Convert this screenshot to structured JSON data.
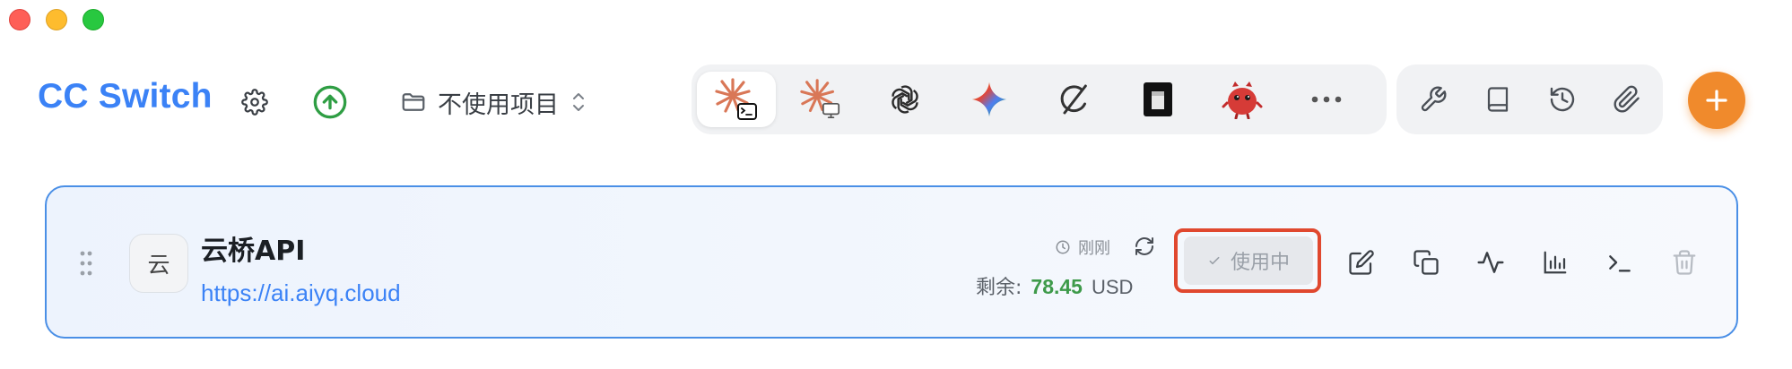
{
  "window": {
    "controls": [
      "close",
      "minimize",
      "zoom"
    ]
  },
  "header": {
    "app_title": "CC Switch",
    "settings_icon": "gear-icon",
    "update_icon": "arrow-up-circle-icon",
    "project_selector": {
      "label": "不使用项目",
      "icon": "folder-icon"
    }
  },
  "tools": [
    {
      "name": "claude-code",
      "icon": "claude-terminal-icon",
      "active": true
    },
    {
      "name": "claude-desktop",
      "icon": "claude-desktop-icon",
      "active": false
    },
    {
      "name": "openai",
      "icon": "openai-icon",
      "active": false
    },
    {
      "name": "gemini",
      "icon": "gemini-icon",
      "active": false
    },
    {
      "name": "grok",
      "icon": "grok-icon",
      "active": false
    },
    {
      "name": "dark-app",
      "icon": "box-icon",
      "active": false
    },
    {
      "name": "mascot",
      "icon": "red-mascot-icon",
      "active": false
    },
    {
      "name": "more",
      "icon": "more-icon",
      "active": false
    }
  ],
  "utilities": [
    {
      "name": "tools",
      "icon": "wrench-icon"
    },
    {
      "name": "docs",
      "icon": "book-icon"
    },
    {
      "name": "history",
      "icon": "history-icon"
    },
    {
      "name": "attachments",
      "icon": "paperclip-icon"
    }
  ],
  "add_button": {
    "icon": "plus-icon"
  },
  "provider": {
    "avatar_text": "云",
    "name": "云桥API",
    "url": "https://ai.aiyq.cloud",
    "updated": "刚刚",
    "balance_label": "剩余:",
    "balance_amount": "78.45",
    "balance_currency": "USD",
    "status_label": "使用中"
  },
  "colors": {
    "brand": "#3b82f6",
    "add_button": "#f08a2c",
    "highlight": "#e0482f",
    "balance": "#3e9a4a",
    "card_border": "#4a8fe6"
  }
}
